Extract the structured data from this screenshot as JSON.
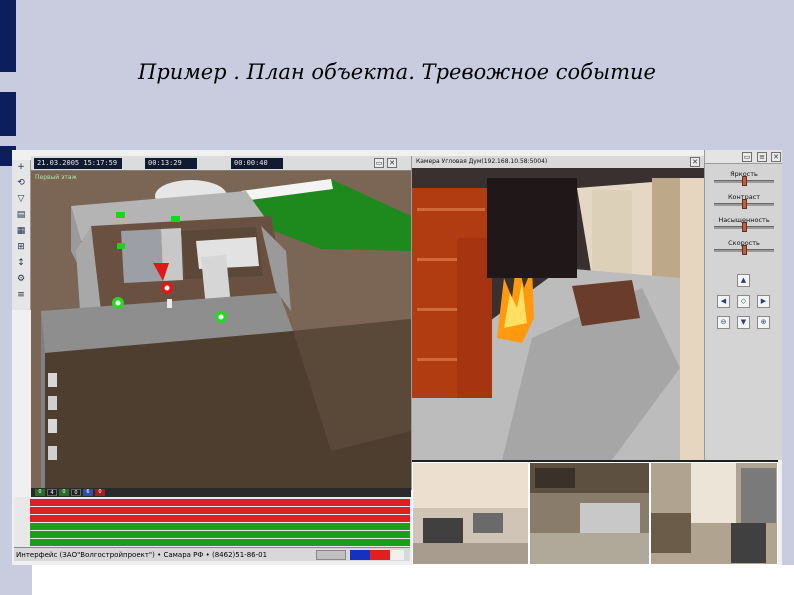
{
  "slide": {
    "title": "Пример . План объекта. Тревожное событие"
  },
  "plan": {
    "header": {
      "datetime": "21.03.2005 15:17:59",
      "timer1": "00:13:29",
      "timer2": "00:00:40"
    },
    "floor_label": "Первый этаж"
  },
  "camera": {
    "title": "Камера Угловая Дум(192.168.10.58:5004)"
  },
  "controls": {
    "sliders": [
      {
        "label": "Яркость",
        "level": 0.5
      },
      {
        "label": "Контраст",
        "level": 0.5
      },
      {
        "label": "Насыщенность",
        "level": 0.5
      },
      {
        "label": "Скорость",
        "level": 0.5
      }
    ]
  },
  "status": {
    "company": "Интерфейс (ЗАО\"Волгостройпроект\") • Самара РФ • (8462)51-86-01",
    "colors": {
      "alarm": "#e02020",
      "normal": "#18a018",
      "flag_blue": "#1830c0",
      "flag_red": "#e02020"
    }
  },
  "chips": [
    "0",
    "4",
    "0",
    "0",
    "6",
    "0"
  ]
}
